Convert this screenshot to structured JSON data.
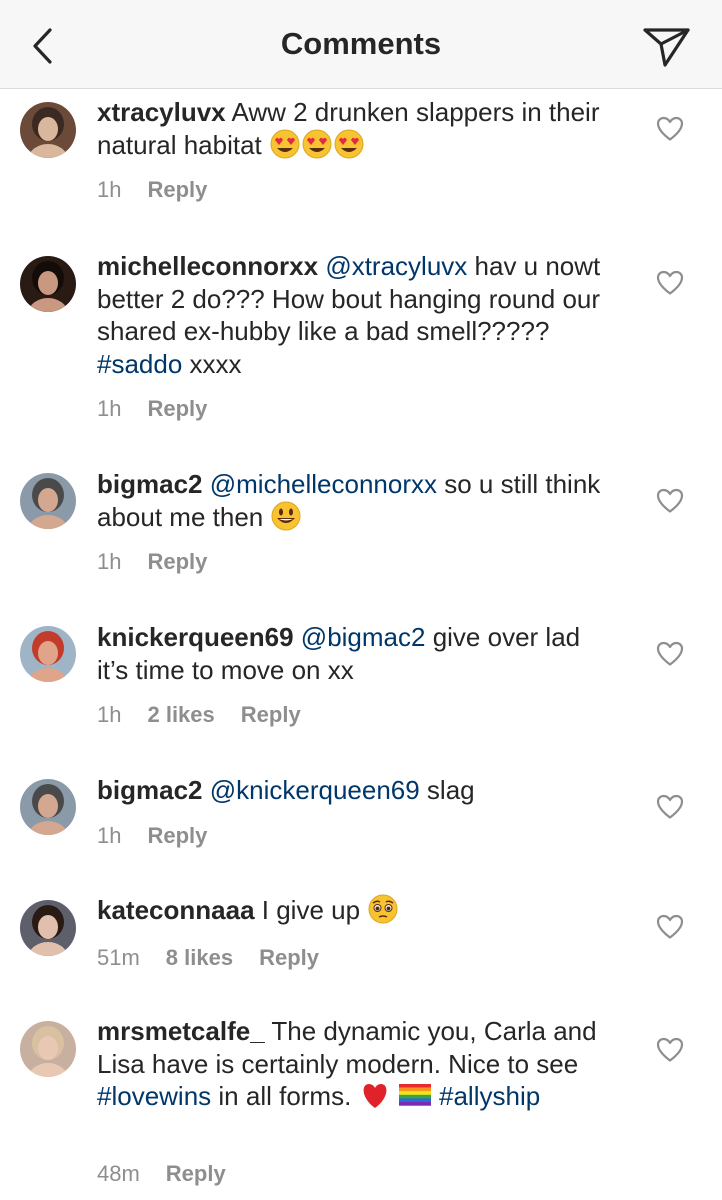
{
  "header": {
    "title": "Comments",
    "back_icon": "chevron-left-icon",
    "send_icon": "paper-plane-icon"
  },
  "comments": [
    {
      "username": "xtracyluvx",
      "parts": [
        {
          "t": "text",
          "v": " Aww 2 drunken slappers in their natural habitat "
        },
        {
          "t": "emoji",
          "v": "heart-eyes"
        },
        {
          "t": "emoji",
          "v": "heart-eyes"
        },
        {
          "t": "emoji",
          "v": "heart-eyes"
        }
      ],
      "time": "1h",
      "likes": "",
      "reply": "Reply"
    },
    {
      "username": "michelleconnorxx",
      "parts": [
        {
          "t": "text",
          "v": " "
        },
        {
          "t": "link",
          "v": "@xtracyluvx"
        },
        {
          "t": "text",
          "v": " hav u nowt better 2 do??? How bout hanging round our shared ex-hubby like a bad smell????? "
        },
        {
          "t": "link",
          "v": "#saddo"
        },
        {
          "t": "text",
          "v": " xxxx"
        }
      ],
      "time": "1h",
      "likes": "",
      "reply": "Reply"
    },
    {
      "username": "bigmac2",
      "parts": [
        {
          "t": "text",
          "v": " "
        },
        {
          "t": "link",
          "v": "@michelleconnorxx"
        },
        {
          "t": "text",
          "v": " so u still think about me then "
        },
        {
          "t": "emoji",
          "v": "grin"
        }
      ],
      "time": "1h",
      "likes": "",
      "reply": "Reply"
    },
    {
      "username": "knickerqueen69",
      "parts": [
        {
          "t": "text",
          "v": " "
        },
        {
          "t": "link",
          "v": "@bigmac2"
        },
        {
          "t": "text",
          "v": " give over lad it’s time to move on xx"
        }
      ],
      "time": "1h",
      "likes": "2 likes",
      "reply": "Reply"
    },
    {
      "username": "bigmac2",
      "parts": [
        {
          "t": "text",
          "v": " "
        },
        {
          "t": "link",
          "v": "@knickerqueen69"
        },
        {
          "t": "text",
          "v": " slag"
        }
      ],
      "time": "1h",
      "likes": "",
      "reply": "Reply"
    },
    {
      "username": "kateconnaaa",
      "parts": [
        {
          "t": "text",
          "v": " I give up "
        },
        {
          "t": "emoji",
          "v": "pleading"
        }
      ],
      "time": "51m",
      "likes": "8 likes",
      "reply": "Reply"
    },
    {
      "username": "mrsmetcalfe_",
      "parts": [
        {
          "t": "text",
          "v": " The dynamic you, Carla and Lisa have is certainly modern. Nice to see "
        },
        {
          "t": "link",
          "v": "#lovewins"
        },
        {
          "t": "text",
          "v": " in all forms. "
        },
        {
          "t": "emoji",
          "v": "red-heart"
        },
        {
          "t": "text",
          "v": " "
        },
        {
          "t": "emoji",
          "v": "rainbow-flag"
        },
        {
          "t": "text",
          "v": " "
        },
        {
          "t": "link",
          "v": "#allyship"
        }
      ],
      "time": "48m",
      "likes": "",
      "reply": "Reply"
    }
  ],
  "colors": {
    "text": "#262626",
    "meta": "#8e8e8e",
    "link": "#00376b",
    "header_bg": "#f7f7f7"
  }
}
